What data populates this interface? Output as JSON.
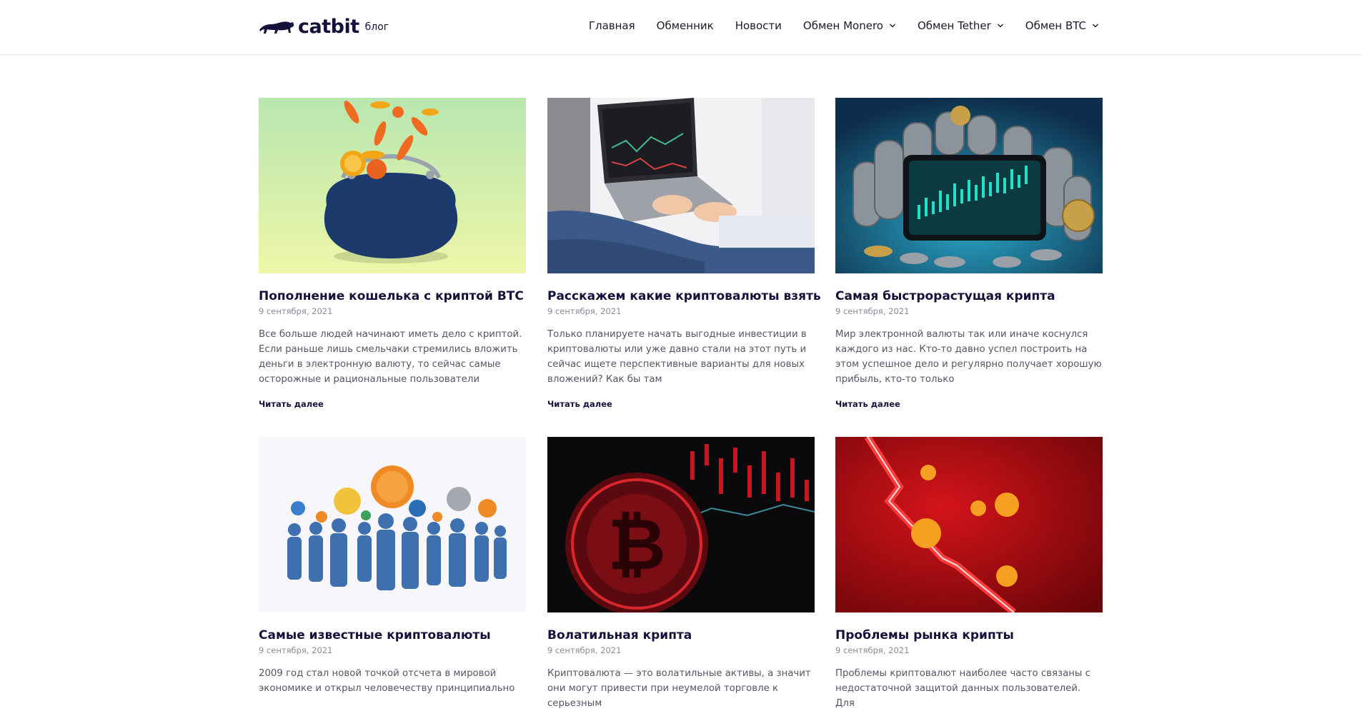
{
  "header": {
    "logo_name": "catbit",
    "logo_sub": "блог",
    "nav": [
      {
        "label": "Главная",
        "dropdown": false
      },
      {
        "label": "Обменник",
        "dropdown": false
      },
      {
        "label": "Новости",
        "dropdown": false
      },
      {
        "label": "Обмен Monero",
        "dropdown": true
      },
      {
        "label": "Обмен Tether",
        "dropdown": true
      },
      {
        "label": "Обмен BTC",
        "dropdown": true
      }
    ]
  },
  "posts": [
    {
      "title": "Пополнение кошелька с криптой BTC",
      "date": "9 сентября, 2021",
      "excerpt": "Все больше людей начинают иметь дело с криптой. Если раньше лишь смельчаки стремились вложить деньги в электронную валюту, то сейчас самые осторожные и рациональные пользователи понимают,",
      "more": "Читать далее",
      "image": "purse-with-coins"
    },
    {
      "title": "Расскажем какие криптовалюты взять",
      "date": "9 сентября, 2021",
      "excerpt": "Только планируете начать выгодные инвестиции в криптовалюты или уже давно стали на этот путь и сейчас ищете перспективные варианты для новых вложений? Как бы там",
      "more": "Читать далее",
      "image": "laptop-trading"
    },
    {
      "title": "Самая быстрорастущая крипта",
      "date": "9 сентября, 2021",
      "excerpt": "Мир электронной валюты так или иначе коснулся каждого из нас. Кто-то давно успел построить на этом успешное дело и регулярно получает хорошую прибыль, кто-то только",
      "more": "Читать далее",
      "image": "phone-with-coins"
    },
    {
      "title": "Самые известные криптовалюты",
      "date": "9 сентября, 2021",
      "excerpt": "2009 год стал новой точкой отсчета в мировой экономике и открыл человечеству принципиально",
      "more": "Читать далее",
      "image": "people-crypto-icons"
    },
    {
      "title": "Волатильная крипта",
      "date": "9 сентября, 2021",
      "excerpt": "Криптовалюта — это волатильные активы, а значит они могут привести при неумелой торговле к серьезным",
      "more": "Читать далее",
      "image": "red-bitcoin"
    },
    {
      "title": "Проблемы рынка крипты",
      "date": "9 сентября, 2021",
      "excerpt": "Проблемы криптовалют наиболее часто связаны с недостаточной защитой данных пользователей. Для",
      "more": "Читать далее",
      "image": "falling-chart"
    }
  ]
}
